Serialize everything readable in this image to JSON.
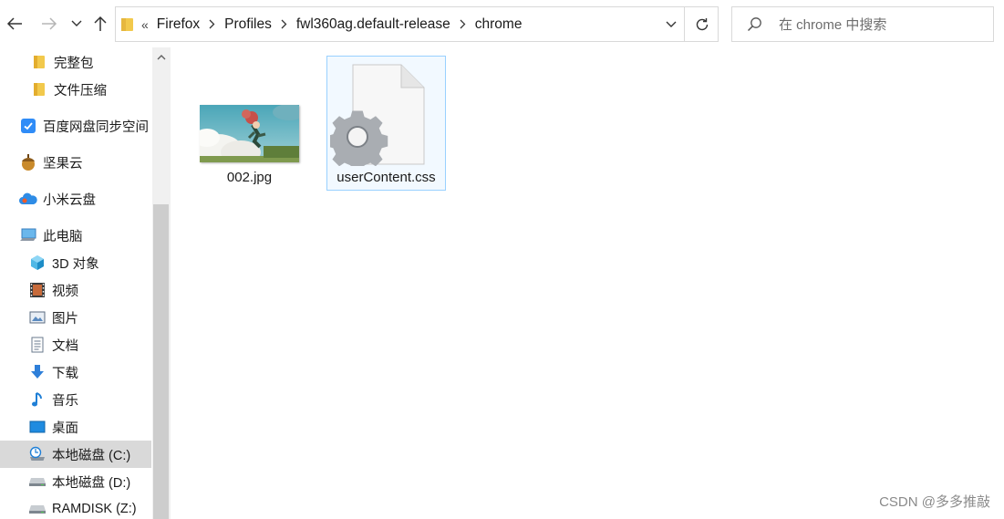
{
  "toolbar": {
    "back_icon": "arrow-left-icon",
    "forward_icon": "arrow-right-icon",
    "recent_icon": "chevron-down-icon",
    "up_icon": "arrow-up-icon"
  },
  "address": {
    "overflow": "«",
    "crumbs": [
      "Firefox",
      "Profiles",
      "fwl360ag.default-release",
      "chrome"
    ]
  },
  "search": {
    "placeholder": "在 chrome 中搜索"
  },
  "sidebar": {
    "items": [
      {
        "label": "完整包",
        "icon": "folder-icon"
      },
      {
        "label": "文件压缩",
        "icon": "folder-icon"
      },
      {
        "label": "百度网盘同步空间",
        "icon": "baidu-netdisk-icon"
      },
      {
        "label": "坚果云",
        "icon": "nutstore-icon"
      },
      {
        "label": "小米云盘",
        "icon": "mi-cloud-icon"
      },
      {
        "label": "此电脑",
        "icon": "computer-icon"
      },
      {
        "label": "3D 对象",
        "icon": "3d-objects-icon"
      },
      {
        "label": "视频",
        "icon": "video-icon"
      },
      {
        "label": "图片",
        "icon": "pictures-icon"
      },
      {
        "label": "文档",
        "icon": "documents-icon"
      },
      {
        "label": "下载",
        "icon": "download-icon"
      },
      {
        "label": "音乐",
        "icon": "music-icon"
      },
      {
        "label": "桌面",
        "icon": "desktop-icon"
      },
      {
        "label": "本地磁盘 (C:)",
        "icon": "system-drive-icon",
        "selected": true
      },
      {
        "label": "本地磁盘 (D:)",
        "icon": "drive-icon"
      },
      {
        "label": "RAMDISK (Z:)",
        "icon": "drive-icon"
      }
    ]
  },
  "files": [
    {
      "name": "002.jpg",
      "icon": "image-thumbnail"
    },
    {
      "name": "userContent.css",
      "icon": "settings-file-icon",
      "selected": true
    }
  ],
  "watermark": "CSDN @多多推敲",
  "colors": {
    "selection": "#d9d9d9",
    "file_selection_border": "#99d1ff",
    "accent": "#0078d7"
  }
}
